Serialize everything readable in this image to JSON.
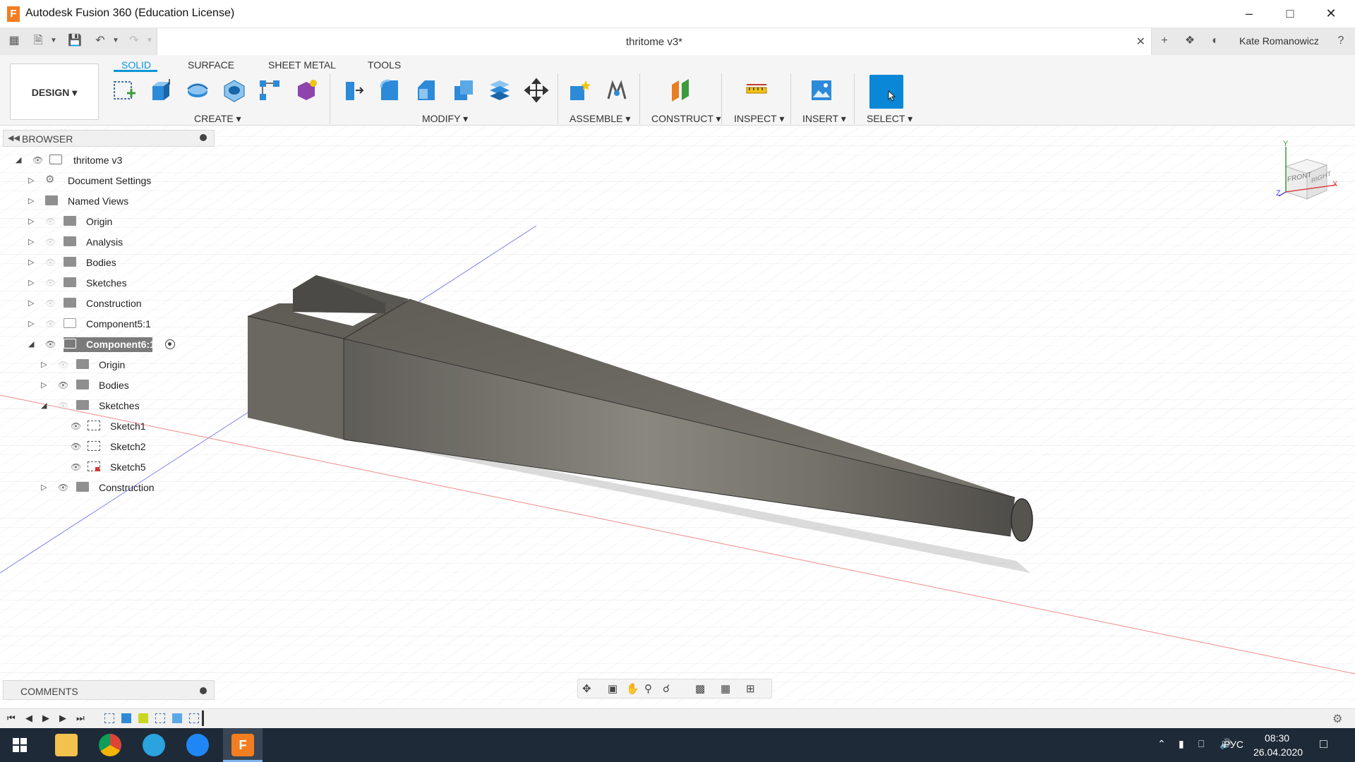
{
  "app": {
    "title": "Autodesk Fusion 360 (Education License)",
    "icon_letter": "F"
  },
  "document": {
    "tab_title": "thritome v3*",
    "user": "Kate Romanowicz"
  },
  "ribbon": {
    "workspace": "DESIGN ▾",
    "tabs": [
      "SOLID",
      "SURFACE",
      "SHEET METAL",
      "TOOLS"
    ],
    "groups": [
      "CREATE ▾",
      "MODIFY ▾",
      "ASSEMBLE ▾",
      "CONSTRUCT ▾",
      "INSPECT ▾",
      "INSERT ▾",
      "SELECT ▾"
    ]
  },
  "browser": {
    "title": "BROWSER",
    "items": [
      {
        "label": "thritome v3"
      },
      {
        "label": "Document Settings"
      },
      {
        "label": "Named Views"
      },
      {
        "label": "Origin"
      },
      {
        "label": "Analysis"
      },
      {
        "label": "Bodies"
      },
      {
        "label": "Sketches"
      },
      {
        "label": "Construction"
      },
      {
        "label": "Component5:1"
      },
      {
        "label": "Component6:1"
      },
      {
        "label": "Origin"
      },
      {
        "label": "Bodies"
      },
      {
        "label": "Sketches"
      },
      {
        "label": "Sketch1"
      },
      {
        "label": "Sketch2"
      },
      {
        "label": "Sketch5"
      },
      {
        "label": "Construction"
      }
    ]
  },
  "comments": {
    "title": "COMMENTS"
  },
  "viewcube": {
    "front": "FRONT",
    "right": "RIGHT",
    "axis_y": "Y",
    "axis_x": "X",
    "axis_z": "Z"
  },
  "taskbar": {
    "lang": "РУС",
    "time": "08:30",
    "date": "26.04.2020"
  },
  "colors": {
    "accent": "#0696d7",
    "orange": "#f37d21",
    "body": "#6e6b63"
  }
}
